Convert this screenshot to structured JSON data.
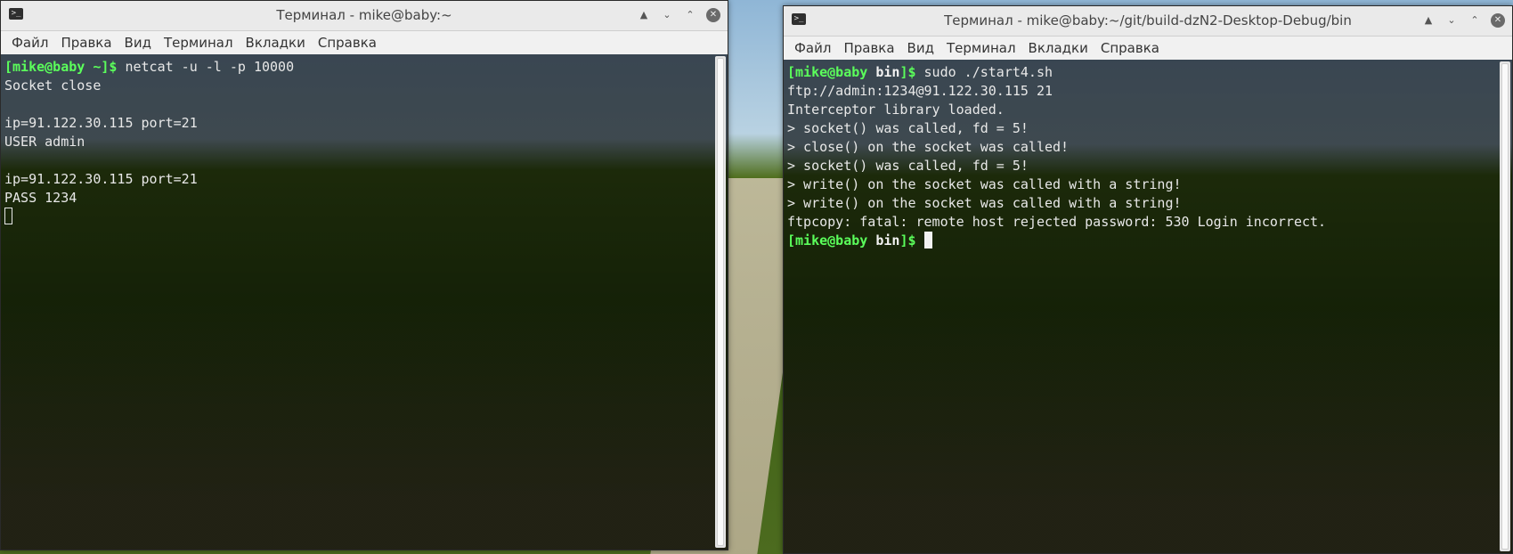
{
  "left_window": {
    "title": "Терминал - mike@baby:~",
    "menu": [
      "Файл",
      "Правка",
      "Вид",
      "Терминал",
      "Вкладки",
      "Справка"
    ],
    "prompt": "[mike@baby ~]$",
    "command": " netcat -u -l -p 10000",
    "output": [
      "Socket close",
      "",
      "ip=91.122.30.115 port=21",
      "USER admin",
      "",
      "ip=91.122.30.115 port=21",
      "PASS 1234"
    ]
  },
  "right_window": {
    "title": "Терминал - mike@baby:~/git/build-dzN2-Desktop-Debug/bin",
    "menu": [
      "Файл",
      "Правка",
      "Вид",
      "Терминал",
      "Вкладки",
      "Справка"
    ],
    "prompt_user": "[mike@baby ",
    "prompt_dir": "bin",
    "prompt_end": "]$",
    "command": " sudo ./start4.sh",
    "output": [
      "ftp://admin:1234@91.122.30.115 21",
      "Interceptor library loaded.",
      "> socket() was called, fd = 5!",
      "> close() on the socket was called!",
      "> socket() was called, fd = 5!",
      "> write() on the socket was called with a string!",
      "> write() on the socket was called with a string!",
      "ftpcopy: fatal: remote host rejected password: 530 Login incorrect."
    ]
  },
  "icons": {
    "app": "terminal-icon",
    "shade": "shade-icon",
    "minimize": "minimize-icon",
    "maximize": "maximize-icon",
    "close": "close-icon"
  }
}
